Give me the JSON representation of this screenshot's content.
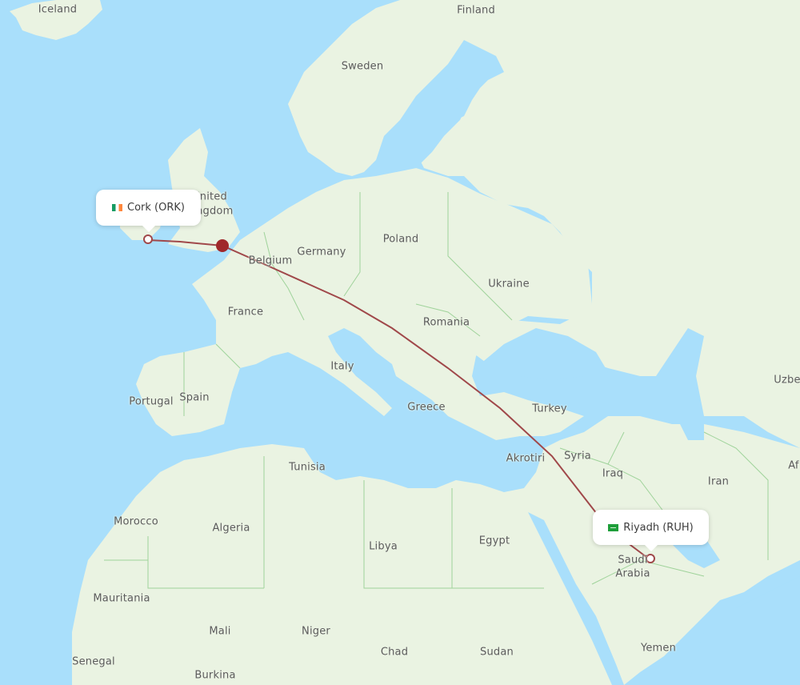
{
  "map": {
    "route_color": "#a0484a",
    "water_color": "#a9dffb",
    "land_color": "#eaf3e2",
    "border_color": "#9fd39a",
    "origin": {
      "label": "Cork (ORK)",
      "flag": "ireland-flag-icon"
    },
    "destination": {
      "label": "Riyadh (RUH)",
      "flag": "saudi-arabia-flag-icon"
    },
    "stopover": {
      "name": "london-stopover-marker"
    },
    "labels": [
      {
        "id": "iceland",
        "text": "Iceland"
      },
      {
        "id": "finland",
        "text": "Finland"
      },
      {
        "id": "sweden",
        "text": "Sweden"
      },
      {
        "id": "united-kingdom-1",
        "text": "United"
      },
      {
        "id": "united-kingdom-2",
        "text": "Kingdom"
      },
      {
        "id": "poland",
        "text": "Poland"
      },
      {
        "id": "germany",
        "text": "Germany"
      },
      {
        "id": "belgium",
        "text": "Belgium"
      },
      {
        "id": "ukraine",
        "text": "Ukraine"
      },
      {
        "id": "france",
        "text": "France"
      },
      {
        "id": "romania",
        "text": "Romania"
      },
      {
        "id": "italy",
        "text": "Italy"
      },
      {
        "id": "portugal",
        "text": "Portugal"
      },
      {
        "id": "spain",
        "text": "Spain"
      },
      {
        "id": "greece",
        "text": "Greece"
      },
      {
        "id": "turkey",
        "text": "Turkey"
      },
      {
        "id": "uzbekistan",
        "text": "Uzbe"
      },
      {
        "id": "tunisia",
        "text": "Tunisia"
      },
      {
        "id": "akrotiri",
        "text": "Akrotiri"
      },
      {
        "id": "syria",
        "text": "Syria"
      },
      {
        "id": "iraq",
        "text": "Iraq"
      },
      {
        "id": "iran",
        "text": "Iran"
      },
      {
        "id": "afghanistan",
        "text": "Af"
      },
      {
        "id": "morocco",
        "text": "Morocco"
      },
      {
        "id": "algeria",
        "text": "Algeria"
      },
      {
        "id": "libya",
        "text": "Libya"
      },
      {
        "id": "egypt",
        "text": "Egypt"
      },
      {
        "id": "saudi-arabia-1",
        "text": "Saudi"
      },
      {
        "id": "saudi-arabia-2",
        "text": "Arabia"
      },
      {
        "id": "mauritania",
        "text": "Mauritania"
      },
      {
        "id": "mali",
        "text": "Mali"
      },
      {
        "id": "niger",
        "text": "Niger"
      },
      {
        "id": "chad",
        "text": "Chad"
      },
      {
        "id": "sudan",
        "text": "Sudan"
      },
      {
        "id": "yemen",
        "text": "Yemen"
      },
      {
        "id": "senegal",
        "text": "Senegal"
      },
      {
        "id": "burkina",
        "text": "Burkina"
      }
    ]
  }
}
